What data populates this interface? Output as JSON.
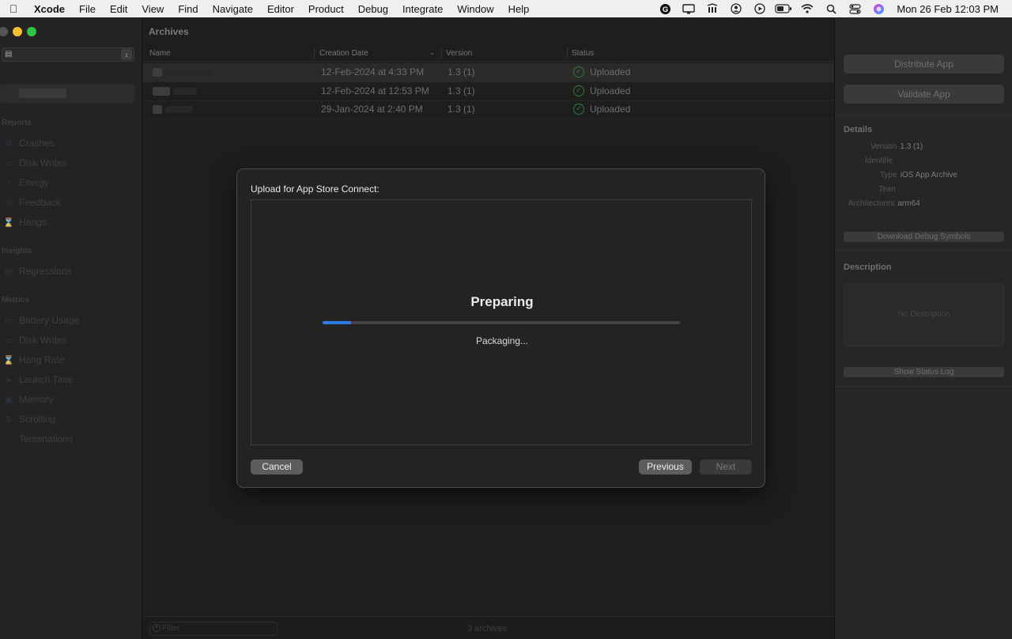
{
  "menubar": {
    "items": [
      "Xcode",
      "File",
      "Edit",
      "View",
      "Find",
      "Navigate",
      "Editor",
      "Product",
      "Debug",
      "Integrate",
      "Window",
      "Help"
    ],
    "clock": "Mon 26 Feb  12:03 PM"
  },
  "sidebar": {
    "sections": {
      "reports": "Reports",
      "insights": "Insights",
      "metrics": "Metrics"
    },
    "reports_items": [
      "Crashes",
      "Disk Writes",
      "Energy",
      "Feedback",
      "Hangs"
    ],
    "insights_items": [
      "Regressions"
    ],
    "metrics_items": [
      "Battery Usage",
      "Disk Writes",
      "Hang Rate",
      "Launch Time",
      "Memory",
      "Scrolling",
      "Terminations"
    ]
  },
  "archives": {
    "title": "Archives",
    "columns": {
      "name": "Name",
      "creation_date": "Creation Date",
      "version": "Version",
      "status": "Status"
    },
    "rows": [
      {
        "date": "12-Feb-2024 at 4:33 PM",
        "version": "1.3 (1)",
        "status": "Uploaded"
      },
      {
        "date": "12-Feb-2024 at 12:53 PM",
        "version": "1.3 (1)",
        "status": "Uploaded"
      },
      {
        "date": "29-Jan-2024 at 2:40 PM",
        "version": "1.3 (1)",
        "status": "Uploaded"
      }
    ],
    "filter_placeholder": "Filter",
    "count": "3 archives"
  },
  "inspector": {
    "distribute": "Distribute App",
    "validate": "Validate App",
    "details_title": "Details",
    "version_label": "Version",
    "version_value": "1.3 (1)",
    "identifier_label": "Identifie",
    "type_label": "Type",
    "type_value": "iOS App Archive",
    "team_label": "Tean",
    "arch_label": "Architectures",
    "arch_value": "arm64",
    "download_symbols": "Download Debug Symbols",
    "description_title": "Description",
    "no_description": "No Description",
    "show_status_log": "Show Status Log"
  },
  "modal": {
    "title": "Upload for App Store Connect:",
    "heading": "Preparing",
    "status": "Packaging...",
    "progress": 0.08,
    "cancel": "Cancel",
    "previous": "Previous",
    "next": "Next"
  },
  "colors": {
    "accent": "#2f7ce8",
    "success": "#2f7d3b"
  }
}
